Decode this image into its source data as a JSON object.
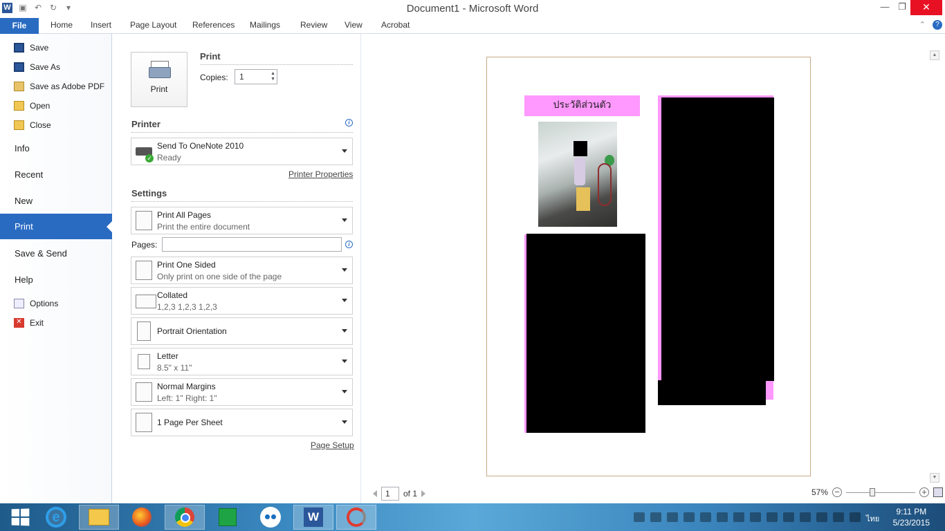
{
  "window": {
    "title": "Document1 - Microsoft Word",
    "app_icon": "W"
  },
  "ribbon": {
    "file_tab": "File",
    "tabs": [
      "Home",
      "Insert",
      "Page Layout",
      "References",
      "Mailings",
      "Review",
      "View",
      "Acrobat"
    ]
  },
  "nav": {
    "save": "Save",
    "save_as": "Save As",
    "save_pdf": "Save as Adobe PDF",
    "open": "Open",
    "close": "Close",
    "info": "Info",
    "recent": "Recent",
    "new": "New",
    "print": "Print",
    "save_send": "Save & Send",
    "help": "Help",
    "options": "Options",
    "exit": "Exit"
  },
  "print": {
    "button_label": "Print",
    "section_title": "Print",
    "copies_label": "Copies:",
    "copies_value": "1"
  },
  "printer": {
    "section_title": "Printer",
    "name": "Send To OneNote 2010",
    "status": "Ready",
    "properties_link": "Printer Properties"
  },
  "settings": {
    "section_title": "Settings",
    "range_main": "Print All Pages",
    "range_sub": "Print the entire document",
    "pages_label": "Pages:",
    "pages_value": "",
    "sided_main": "Print One Sided",
    "sided_sub": "Only print on one side of the page",
    "collate_main": "Collated",
    "collate_sub": "1,2,3    1,2,3    1,2,3",
    "orientation_main": "Portrait Orientation",
    "paper_main": "Letter",
    "paper_sub": "8.5\" x 11\"",
    "margins_main": "Normal Margins",
    "margins_sub": "Left:  1\"    Right:  1\"",
    "persheet_main": "1 Page Per Sheet",
    "page_setup_link": "Page Setup"
  },
  "preview": {
    "thai_heading": "ประวัติส่วนตัว",
    "current_page": "1",
    "of_pages": "of 1",
    "zoom": "57%",
    "zoom_level": 0.57,
    "colors": {
      "highlight": "#ff98ff",
      "redaction": "#000000"
    }
  },
  "taskbar": {
    "apps": [
      "start-icon",
      "internet-explorer-icon",
      "file-explorer-icon",
      "firefox-icon",
      "chrome-icon",
      "store-icon",
      "flickr-icon",
      "word-icon",
      "app-icon"
    ],
    "language": "ไทย",
    "time": "9:11 PM",
    "date": "5/23/2015"
  },
  "colors": {
    "accent": "#2a6bc2",
    "close_button": "#e81123"
  }
}
